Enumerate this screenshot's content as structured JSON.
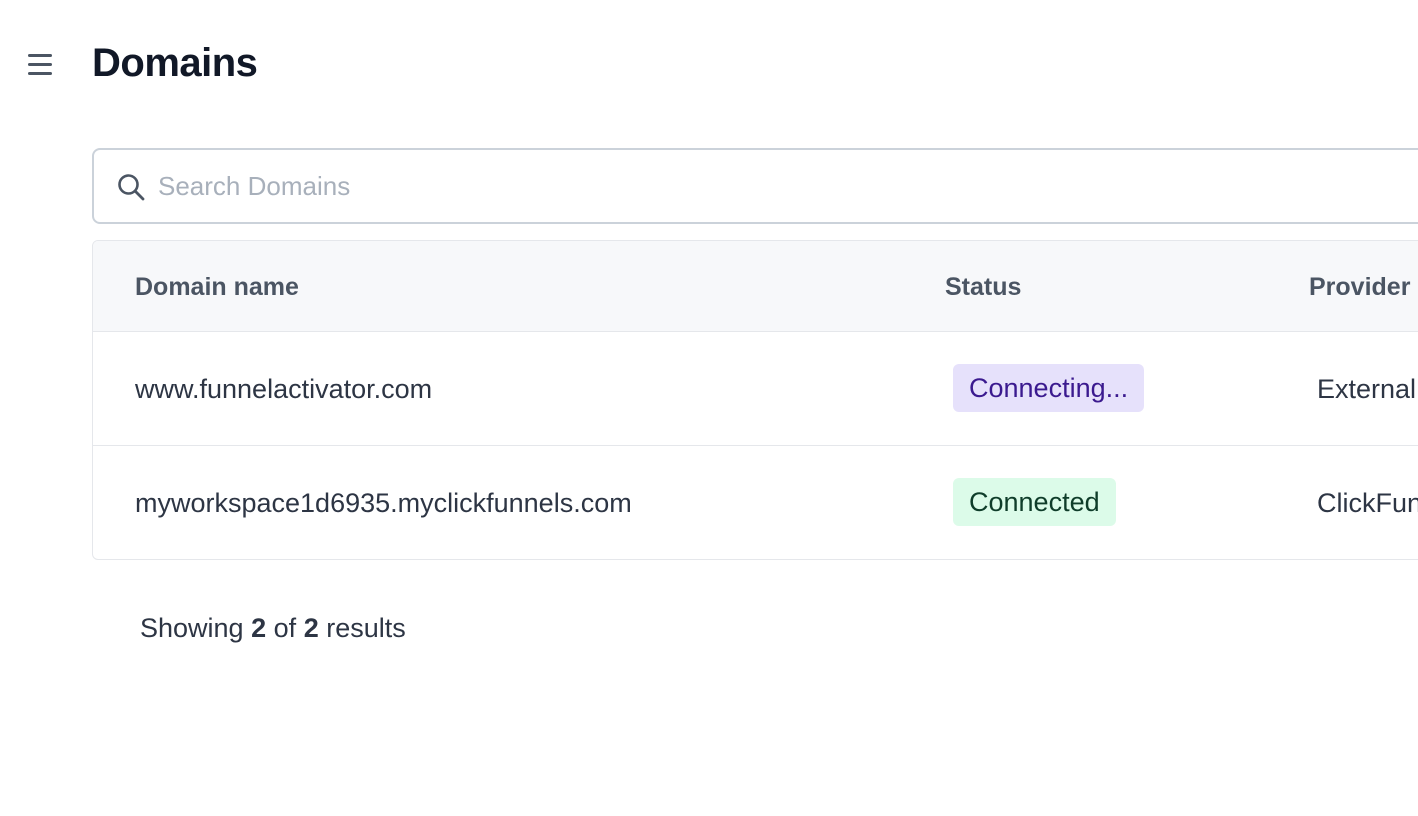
{
  "header": {
    "menu_icon": "hamburger-menu-icon",
    "title": "Domains"
  },
  "search": {
    "icon": "search-icon",
    "placeholder": "Search Domains",
    "value": ""
  },
  "table": {
    "columns": [
      "Domain name",
      "Status",
      "Provider"
    ],
    "rows": [
      {
        "domain": "www.funnelactivator.com",
        "status": "Connecting...",
        "provider": "External"
      },
      {
        "domain": "myworkspace1d6935.myclickfunnels.com",
        "status": "Connected",
        "provider": "ClickFunnels"
      }
    ]
  },
  "status_colors": {
    "connecting_bg": "#e6e1fb",
    "connecting_text": "#3b1a8f",
    "connected_bg": "#dcfbe9",
    "connected_text": "#0f3d2a"
  },
  "footer": {
    "showing": "Showing",
    "count_shown": "2",
    "of": "of",
    "count_total": "2",
    "results": "results"
  }
}
